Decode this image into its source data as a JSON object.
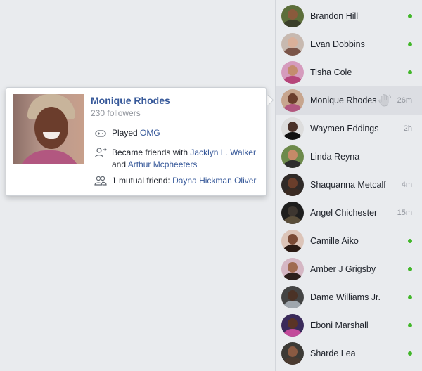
{
  "profile_card": {
    "name": "Monique Rhodes",
    "followers": "230 followers",
    "activity_played_prefix": "Played",
    "activity_played_game": "OMG",
    "became_friends_prefix": "Became friends with",
    "friend_1": "Jacklyn L. Walker",
    "and_text": "and",
    "friend_2": "Arthur Mcpheeters",
    "mutual_prefix": "1 mutual friend:",
    "mutual_friend": "Dayna Hickman Oliver"
  },
  "contacts": [
    {
      "name": "Brandon Hill",
      "status": "online",
      "skin": "#8a5a3c",
      "bg": "#5c6e3a",
      "shirt": "#3b3f2a"
    },
    {
      "name": "Evan Dobbins",
      "status": "online",
      "skin": "#d9b09a",
      "bg": "#c7b9b0",
      "shirt": "#7a5448"
    },
    {
      "name": "Tisha Cole",
      "status": "online",
      "skin": "#c48c6e",
      "bg": "#d59bbd",
      "shirt": "#b6457a"
    },
    {
      "name": "Monique Rhodes",
      "status": "26m",
      "skin": "#6b3d2c",
      "bg": "#c7a58e",
      "shirt": "#b25780"
    },
    {
      "name": "Waymen Eddings",
      "status": "2h",
      "skin": "#4a3128",
      "bg": "#dddddd",
      "shirt": "#111111"
    },
    {
      "name": "Linda Reyna",
      "status": "",
      "skin": "#c68a68",
      "bg": "#6d8a4b",
      "shirt": "#2d2d2d"
    },
    {
      "name": "Shaquanna Metcalf",
      "status": "4m",
      "skin": "#6a3e2b",
      "bg": "#2f2a28",
      "shirt": "#3a2a22"
    },
    {
      "name": "Angel Chichester",
      "status": "15m",
      "skin": "#3d3630",
      "bg": "#1e1e1e",
      "shirt": "#5a4e3a"
    },
    {
      "name": "Camille Aiko",
      "status": "online",
      "skin": "#7a4a35",
      "bg": "#dcc4b8",
      "shirt": "#2a1a14"
    },
    {
      "name": "Amber J Grigsby",
      "status": "online",
      "skin": "#a06a50",
      "bg": "#d5b7c4",
      "shirt": "#2c1f1c"
    },
    {
      "name": "Dame Williams Jr.",
      "status": "online",
      "skin": "#4b3226",
      "bg": "#444444",
      "shirt": "#9fa6ad"
    },
    {
      "name": "Eboni Marshall",
      "status": "online",
      "skin": "#5a3426",
      "bg": "#3a2a5a",
      "shirt": "#c24a9a"
    },
    {
      "name": "Sharde Lea",
      "status": "online",
      "skin": "#8a5a42",
      "bg": "#3c3a36",
      "shirt": "#4a3a30"
    }
  ],
  "colors": {
    "link": "#365899",
    "online": "#42b72a",
    "muted": "#90949c"
  },
  "icons": {
    "played": "gamepad-icon",
    "became_friends": "add-friend-icon",
    "mutual": "mutual-friends-icon",
    "wave": "wave-hand-icon"
  }
}
